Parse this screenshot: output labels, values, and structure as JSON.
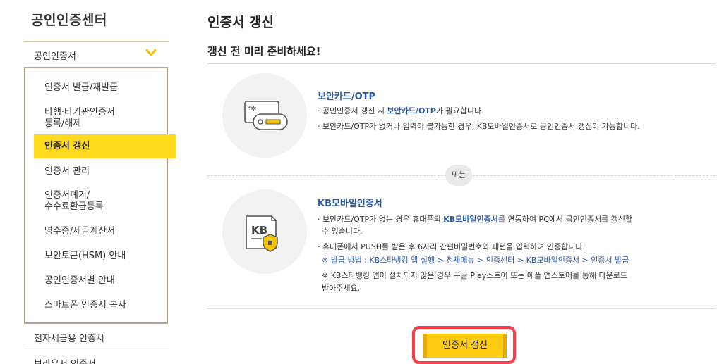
{
  "sidebar": {
    "title": "공인인증센터",
    "category": "공인인증서",
    "items": [
      {
        "label": "인증서 발급/재발급"
      },
      {
        "label": "타행·타기관인증서",
        "label2": "등록/해제"
      },
      {
        "label": "인증서 갱신",
        "active": true
      },
      {
        "label": "인증서 관리"
      },
      {
        "label": "인증서폐기/",
        "label2": "수수료환급등록"
      },
      {
        "label": "영수증/세금계산서"
      },
      {
        "label": "보안토큰(HSM) 안내"
      },
      {
        "label": "공인인증서별 안내"
      },
      {
        "label": "스마트폰 인증서 복사"
      }
    ],
    "extra_items": [
      "전자세금용 인증서",
      "브라우저 인증서"
    ]
  },
  "main": {
    "title": "인증서 갱신",
    "section_title": "갱신 전 미리 준비하세요!",
    "top_crumb": "",
    "option1": {
      "title": "보안카드/OTP",
      "bullet1_pre": "· 공인인증서 갱신 시 ",
      "bullet1_hl": "보안카드/OTP",
      "bullet1_post": "가 필요합니다.",
      "bullet2": "· 보안카드/OTP가 없거나 입력이 불가능한 경우, KB모바일인증서로 공인인증서 갱신이 가능합니다."
    },
    "or_label": "또는",
    "option2": {
      "title": "KB모바일인증서",
      "bullet1_pre": "· 보안카드/OTP가 없는 경우 휴대폰의 ",
      "bullet1_hl": "KB모바일인증서",
      "bullet1_post": "를 연동하여 PC에서 공인인증서를 갱신할",
      "bullet1_cont": "수 있습니다.",
      "bullet2": "· 휴대폰에서 PUSH를 받은 후 6자리 간편비밀번호와 패턴을 입력하여 인증합니다.",
      "note1": "※ 발급 방법 : KB스타뱅킹 앱 실행 > 전체메뉴 > 인증센터 > KB모바일인증서 > 인증서 발급",
      "note2": "※ KB스타뱅킹 앱이 설치되지 않은 경우 구글 Play스토어 또는 애플 앱스토어를 통해 다운로드",
      "note2_cont": "받아주세요.",
      "kb_text": "KB"
    },
    "renew_button": "인증서 갱신"
  },
  "colors": {
    "accent_yellow": "#ffd91b",
    "button_yellow": "#ffcc12",
    "link_blue": "#2b5aa6",
    "highlight_red": "#ff3b45"
  }
}
